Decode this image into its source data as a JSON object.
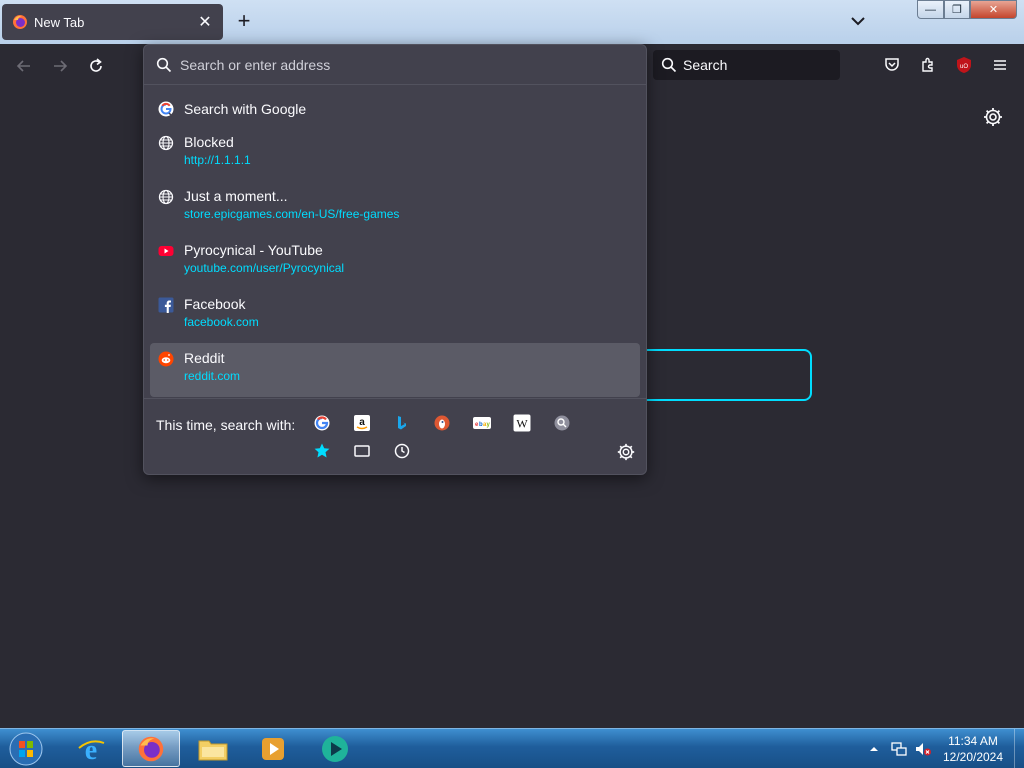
{
  "browser": {
    "tab": {
      "title": "New Tab",
      "close_glyph": "✕"
    },
    "new_tab_glyph": "+",
    "window_buttons": {
      "minimize": "—",
      "maximize": "❐",
      "close": "✕"
    }
  },
  "toolbar": {
    "search_placeholder": "Search",
    "icons": [
      "back-icon",
      "forward-icon",
      "reload-icon",
      "pocket-icon",
      "extensions-icon",
      "ublock-icon",
      "menu-icon"
    ],
    "ublock_label": "uO"
  },
  "urlbar": {
    "placeholder": "Search or enter address",
    "results": [
      {
        "icon": "google-icon",
        "title": "Search with Google",
        "url": ""
      },
      {
        "icon": "globe-icon",
        "title": "Blocked",
        "url": "http://1.1.1.1"
      },
      {
        "icon": "globe-icon",
        "title": "Just a moment...",
        "url": "store.epicgames.com/en-US/free-games"
      },
      {
        "icon": "youtube-icon",
        "title": "Pyrocynical - YouTube",
        "url": "youtube.com/user/Pyrocynical"
      },
      {
        "icon": "facebook-icon",
        "title": "Facebook",
        "url": "facebook.com"
      },
      {
        "icon": "reddit-icon",
        "title": "Reddit",
        "url": "reddit.com",
        "selected": true
      }
    ],
    "one_off_label": "This time, search with:",
    "engines": [
      "google",
      "amazon",
      "bing",
      "duckduckgo",
      "ebay",
      "wikipedia",
      "search"
    ],
    "local_modes": [
      "bookmarks",
      "tabs",
      "history"
    ]
  },
  "taskbar": {
    "apps": [
      "internet-explorer",
      "firefox",
      "file-explorer",
      "media-player",
      "app"
    ],
    "clock": {
      "time": "11:34 AM",
      "date": "12/20/2024"
    }
  },
  "colors": {
    "accent": "#00ddff",
    "dropdown_bg": "#42414d",
    "selected_row": "#5b5b66",
    "page_bg": "#2b2a33"
  }
}
